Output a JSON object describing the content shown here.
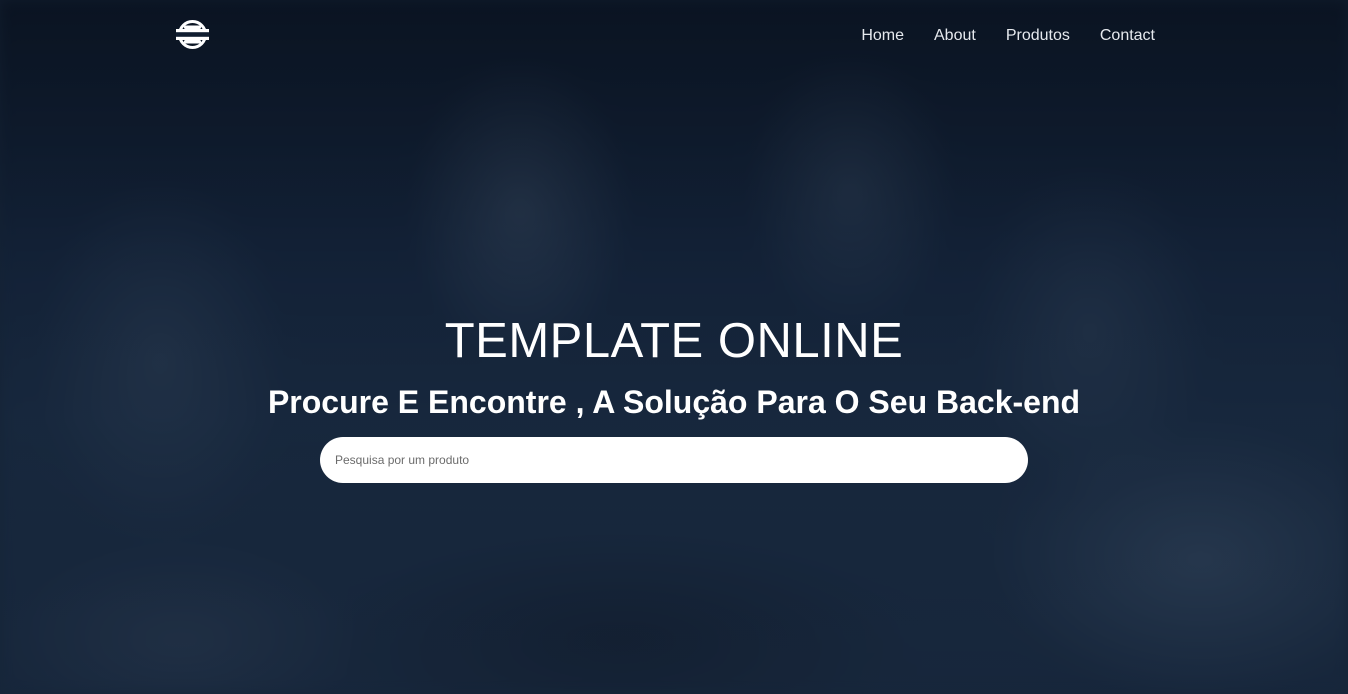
{
  "navbar": {
    "logo_icon": "s-circle-logo-icon",
    "links": [
      {
        "label": "Home"
      },
      {
        "label": "About"
      },
      {
        "label": "Produtos"
      },
      {
        "label": "Contact"
      }
    ]
  },
  "hero": {
    "title": "TEMPLATE ONLINE",
    "subtitle": "Procure E Encontre , A Solução Para O Seu Back-end",
    "search": {
      "placeholder": "Pesquisa por um produto",
      "value": ""
    }
  },
  "colors": {
    "background_overlay": "#1a2a3f",
    "text": "#ffffff",
    "nav_text": "#e6e9ee",
    "search_bg": "#ffffff"
  }
}
